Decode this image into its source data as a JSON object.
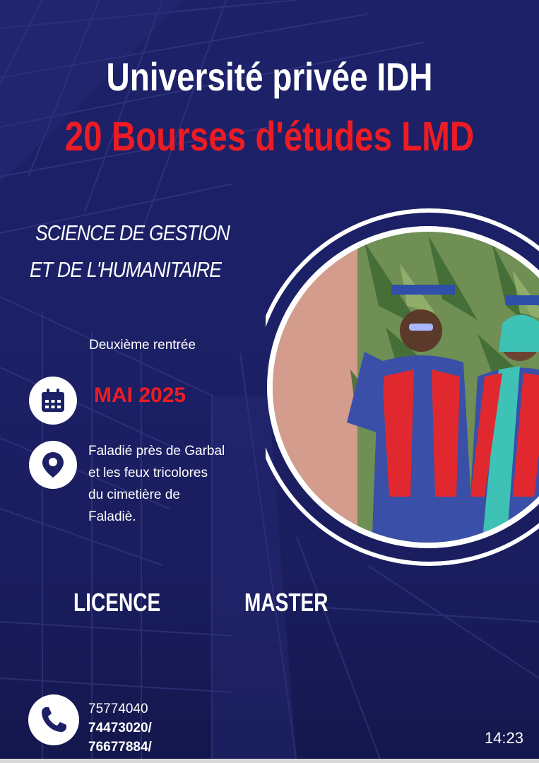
{
  "colors": {
    "navy": "#1c2066",
    "red": "#ed1c24",
    "white": "#ffffff"
  },
  "header": {
    "title": "Université privée IDH",
    "subtitle": "20 Bourses d'études LMD"
  },
  "program": {
    "line1": "SCIENCE DE GESTION",
    "line2": "ET DE L'HUMANITAIRE"
  },
  "intake": {
    "label": "Deuxième rentrée",
    "date": "MAI 2025",
    "date_icon": "calendar-icon"
  },
  "location": {
    "icon": "map-pin-icon",
    "lines": [
      "Faladié près de Garbal",
      "et les feux tricolores",
      "du cimetière de",
      "Faladiè."
    ]
  },
  "degrees": [
    "LICENCE",
    "MASTER"
  ],
  "contact": {
    "icon": "phone-icon",
    "numbers": [
      "75774040",
      "74473020/",
      "76677884/"
    ]
  },
  "status": {
    "time": "14:23"
  }
}
